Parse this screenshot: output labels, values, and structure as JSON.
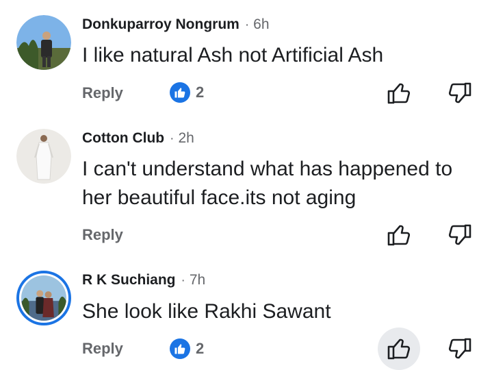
{
  "comments": [
    {
      "author": "Donkuparroy Nongrum",
      "separator": "·",
      "time": "6h",
      "text": "I like natural Ash not Artificial Ash",
      "reply_label": "Reply",
      "like_count": "2",
      "avatar_icon": "user-avatar-outdoor-photo"
    },
    {
      "author": "Cotton Club",
      "separator": "·",
      "time": "2h",
      "text": "I can't understand what has happened to her beautiful face.its not aging",
      "reply_label": "Reply",
      "avatar_icon": "user-avatar-white-dress-photo"
    },
    {
      "author": "R K Suchiang",
      "separator": "·",
      "time": "7h",
      "text": "She look like Rakhi Sawant",
      "reply_label": "Reply",
      "like_count": "2",
      "avatar_icon": "user-avatar-couple-photo"
    }
  ],
  "colors": {
    "accent": "#1b74e4",
    "secondary_text": "#65676b",
    "primary_text": "#1c1e21"
  }
}
